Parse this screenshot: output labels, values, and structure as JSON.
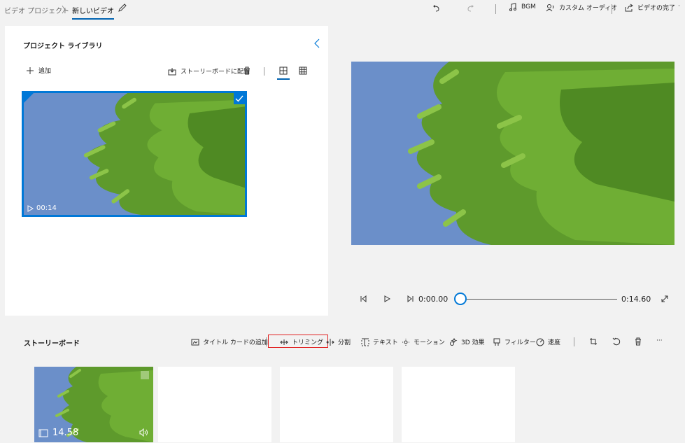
{
  "breadcrumb": {
    "parent": "ビデオ プロジェクト",
    "separator": "〉",
    "current": "新しいビデオ"
  },
  "toolbar": {
    "bgm_label": "BGM",
    "custom_audio_label": "カスタム オーディオ",
    "finish_label": "ビデオの完了",
    "more_label": "·"
  },
  "library": {
    "title": "プロジェクト ライブラリ",
    "add_label": "追加",
    "place_label": "ストーリーボードに配置",
    "clip_duration": "00:14"
  },
  "player": {
    "current_time": "0:00.00",
    "total_time": "0:14.60",
    "progress": 0
  },
  "storyboard": {
    "title": "ストーリーボード",
    "tools": {
      "title_card": "タイトル カードの追加",
      "trim": "トリミング",
      "split": "分割",
      "text": "テキスト",
      "motion": "モーション",
      "effects3d": "3D 効果",
      "filter": "フィルター",
      "speed": "速度",
      "more": "···"
    },
    "first_card_duration": "14.58"
  },
  "colors": {
    "accent": "#0078d7",
    "highlight": "#e02020",
    "sky": "#6b8fc9",
    "leaf": "#5e9a2c"
  }
}
